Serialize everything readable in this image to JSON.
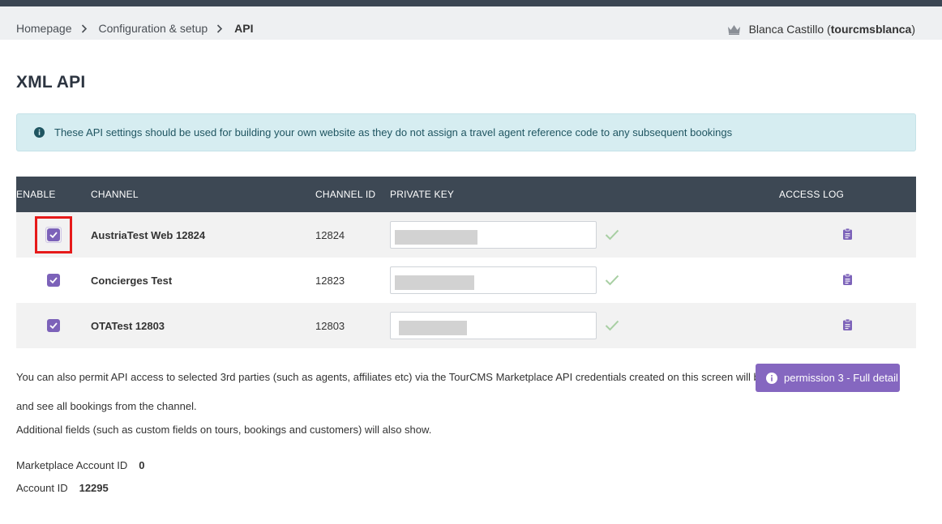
{
  "breadcrumb": {
    "items": [
      "Homepage",
      "Configuration & setup"
    ],
    "current": "API"
  },
  "user": {
    "name": "Blanca Castillo",
    "username": "tourcmsblanca",
    "icon": "crown-icon"
  },
  "page_title": "XML API",
  "info_text": "These API settings should be used for building your own website as they do not assign a travel agent reference code to any subsequent bookings",
  "table": {
    "headers": {
      "enable": "ENABLE",
      "channel": "CHANNEL",
      "channel_id": "CHANNEL ID",
      "private_key": "PRIVATE KEY",
      "access_log": "ACCESS LOG"
    },
    "rows": [
      {
        "enabled": true,
        "channel": "AustriaTest Web 12824",
        "channel_id": "12824",
        "key_valid": true
      },
      {
        "enabled": true,
        "channel": "Concierges Test",
        "channel_id": "12823",
        "key_valid": true
      },
      {
        "enabled": true,
        "channel": "OTATest 12803",
        "channel_id": "12803",
        "key_valid": true
      }
    ]
  },
  "marketplace_text": "You can also permit API access to selected 3rd parties (such as agents, affiliates etc) via the TourCMS Marketplace API credentials created on this screen will be",
  "permission_button": "permission 3 - Full detail",
  "marketplace_text_2": "and see all bookings from the channel.",
  "additional_text": "Additional fields (such as custom fields on tours, bookings and customers) will also show.",
  "marketplace_account": {
    "label": "Marketplace Account ID",
    "value": "0"
  },
  "account": {
    "label": "Account ID",
    "value": "12295"
  },
  "colors": {
    "header_bg": "#3d4854",
    "accent": "#7c62b9",
    "button": "#8567c0",
    "info_bg": "#d6edf1",
    "highlight": "#e61a1a"
  }
}
